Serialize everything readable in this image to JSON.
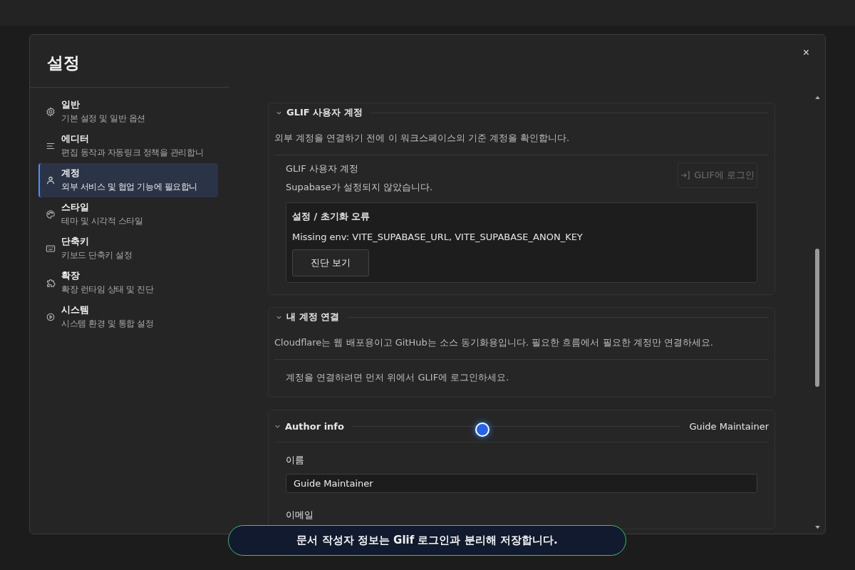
{
  "dialog": {
    "title": "설정",
    "close": "×"
  },
  "sidebar": {
    "items": [
      {
        "label": "일반",
        "description": "기본 설정 및 일반 옵션",
        "selected": false
      },
      {
        "label": "에디터",
        "description": "편집 동작과 자동링크 정책을 관리합니",
        "selected": false
      },
      {
        "label": "계정",
        "description": "외부 서비스 및 협업 기능에 필요합니",
        "selected": true
      },
      {
        "label": "스타일",
        "description": "테마 및 시각적 스타일",
        "selected": false
      },
      {
        "label": "단축키",
        "description": "키보드 단축키 설정",
        "selected": false
      },
      {
        "label": "확장",
        "description": "확장 런타임 상태 및 진단",
        "selected": false
      },
      {
        "label": "시스템",
        "description": "시스템 환경 및 통합 설정",
        "selected": false
      }
    ]
  },
  "sections": [
    {
      "kind": "account",
      "title": "GLIF 사용자 계정",
      "expanded": true,
      "description": "외부 계정을 연결하기 전에 이 워크스페이스의 기준 계정을 확인합니다.",
      "account_label": "GLIF 사용자 계정",
      "status": "Supabase가 설정되지 않았습니다.",
      "login_button": {
        "label": "GLIF에 로그인",
        "disabled": true
      },
      "error": {
        "title": "설정 / 초기화 오류",
        "message": "Missing env: VITE_SUPABASE_URL, VITE_SUPABASE_ANON_KEY",
        "button": "진단 보기"
      }
    },
    {
      "kind": "connections",
      "title": "내 계정 연결",
      "expanded": true,
      "description": "Cloudflare는 웹 배포용이고 GitHub는 소스 동기화용입니다. 필요한 흐름에서 필요한 계정만 연결하세요.",
      "notice": "계정을 연결하려면 먼저 위에서 GLIF에 로그인하세요."
    },
    {
      "kind": "author",
      "title": "Author info",
      "expanded": true,
      "summary": "Guide Maintainer",
      "fields": [
        {
          "label": "이름",
          "value": "Guide Maintainer"
        },
        {
          "label": "이메일"
        }
      ]
    }
  ],
  "toast": {
    "message": "문서 작성자 정보는 Glif 로그인과 분리해 저장합니다."
  }
}
